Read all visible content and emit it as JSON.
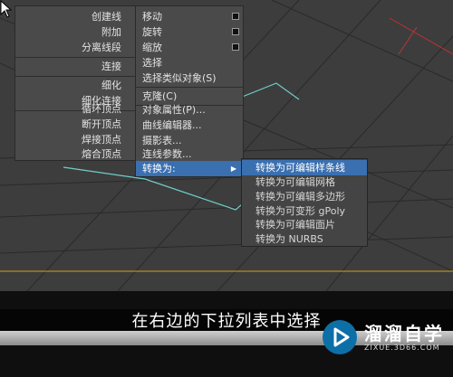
{
  "left_quad": {
    "items": [
      {
        "label": "创建线"
      },
      {
        "label": "附加"
      },
      {
        "label": "分离线段"
      },
      {
        "label": "连接"
      },
      {
        "label": "细化"
      },
      {
        "label": "细化连接"
      },
      {
        "label": "循环顶点"
      },
      {
        "label": "断开顶点"
      },
      {
        "label": "焊接顶点"
      },
      {
        "label": "熔合顶点"
      }
    ]
  },
  "right_quad": {
    "items": [
      {
        "label": "移动"
      },
      {
        "label": "旋转"
      },
      {
        "label": "缩放"
      },
      {
        "label": "选择"
      },
      {
        "label": "选择类似对象(S)"
      },
      {
        "label": "克隆(C)"
      },
      {
        "label": "对象属性(P)..."
      },
      {
        "label": "曲线编辑器..."
      },
      {
        "label": "摄影表..."
      },
      {
        "label": "连线参数..."
      },
      {
        "label": "转换为:"
      }
    ]
  },
  "submenu": {
    "items": [
      {
        "label": "转换为可编辑样条线"
      },
      {
        "label": "转换为可编辑网格"
      },
      {
        "label": "转换为可编辑多边形"
      },
      {
        "label": "转换为可变形 gPoly"
      },
      {
        "label": "转换为可编辑面片"
      },
      {
        "label": "转换为 NURBS"
      }
    ]
  },
  "subtitle": "在右边的下拉列表中选择",
  "watermark": {
    "name": "溜溜自学",
    "url": "ZIXUE.3D66.COM"
  },
  "colors": {
    "highlight": "#3a6fb0",
    "viewport_bg": "#3d3d3d",
    "spline": "#6fd0c8",
    "accent_line": "#d4a020"
  },
  "icons": {
    "logo": "play-triangle-icon",
    "cursor": "mouse-pointer-icon",
    "submenu_arrow": "triangle-right-icon"
  }
}
